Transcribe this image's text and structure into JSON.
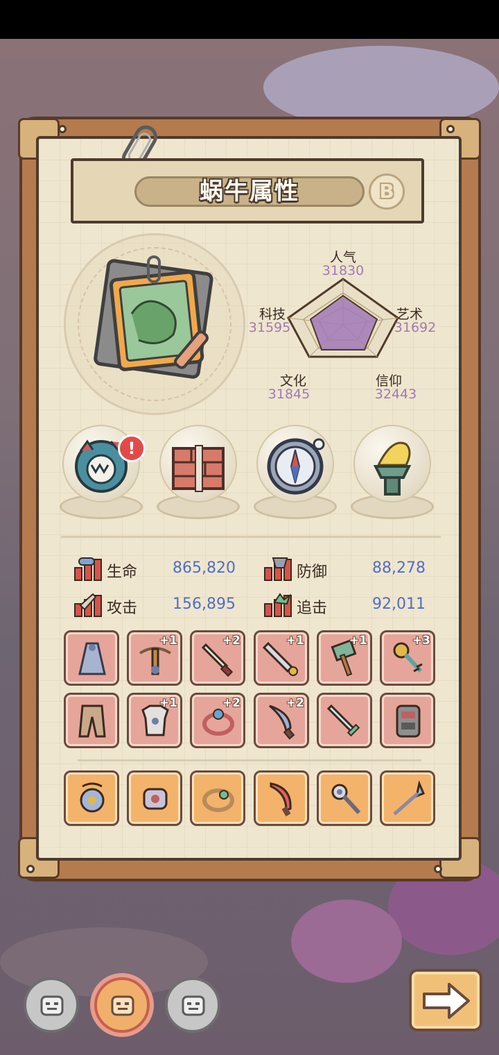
{
  "window": {
    "title": "蜗牛属性",
    "grade": "B"
  },
  "attributes": [
    {
      "label": "人气",
      "value": "31830"
    },
    {
      "label": "艺术",
      "value": "31692"
    },
    {
      "label": "信仰",
      "value": "32443"
    },
    {
      "label": "文化",
      "value": "31845"
    },
    {
      "label": "科技",
      "value": "31595"
    }
  ],
  "relics": [
    {
      "icon": "monster-relic-icon",
      "alert": "!"
    },
    {
      "icon": "brick-stack-icon"
    },
    {
      "icon": "compass-icon"
    },
    {
      "icon": "torch-icon"
    }
  ],
  "combat_stats": [
    {
      "label": "生命",
      "value": "865,820",
      "icon": "health-bar-icon"
    },
    {
      "label": "防御",
      "value": "88,278",
      "icon": "defense-bar-icon"
    },
    {
      "label": "攻击",
      "value": "156,895",
      "icon": "attack-bar-icon"
    },
    {
      "label": "追击",
      "value": "92,011",
      "icon": "pursuit-bar-icon"
    }
  ],
  "equipment_row1": [
    {
      "icon": "cloak-icon",
      "plus": ""
    },
    {
      "icon": "crossbow-icon",
      "plus": "+1"
    },
    {
      "icon": "dagger-icon",
      "plus": "+2"
    },
    {
      "icon": "sword-icon",
      "plus": "+1"
    },
    {
      "icon": "hammer-icon",
      "plus": "+1"
    },
    {
      "icon": "key-staff-icon",
      "plus": "+3"
    }
  ],
  "equipment_row2": [
    {
      "icon": "pants-icon",
      "plus": ""
    },
    {
      "icon": "armor-icon",
      "plus": "+1"
    },
    {
      "icon": "ring-icon",
      "plus": "+2"
    },
    {
      "icon": "knife-icon",
      "plus": "+2"
    },
    {
      "icon": "shortsword-icon",
      "plus": ""
    },
    {
      "icon": "tablet-icon",
      "plus": ""
    }
  ],
  "equipment_row3": [
    {
      "icon": "amulet-icon"
    },
    {
      "icon": "bracer-icon"
    },
    {
      "icon": "bracelet-icon"
    },
    {
      "icon": "curved-blade-icon"
    },
    {
      "icon": "wand-icon"
    },
    {
      "icon": "spear-icon"
    }
  ],
  "bottom_nav": [
    {
      "icon": "robot-face-icon",
      "state": "inactive"
    },
    {
      "icon": "robot-face-icon",
      "state": "active"
    },
    {
      "icon": "robot-face-icon",
      "state": "inactive"
    }
  ],
  "colors": {
    "stat_value": "#4f6ec4",
    "attr_value": "#a07ab2",
    "paper": "#efe6cf"
  }
}
